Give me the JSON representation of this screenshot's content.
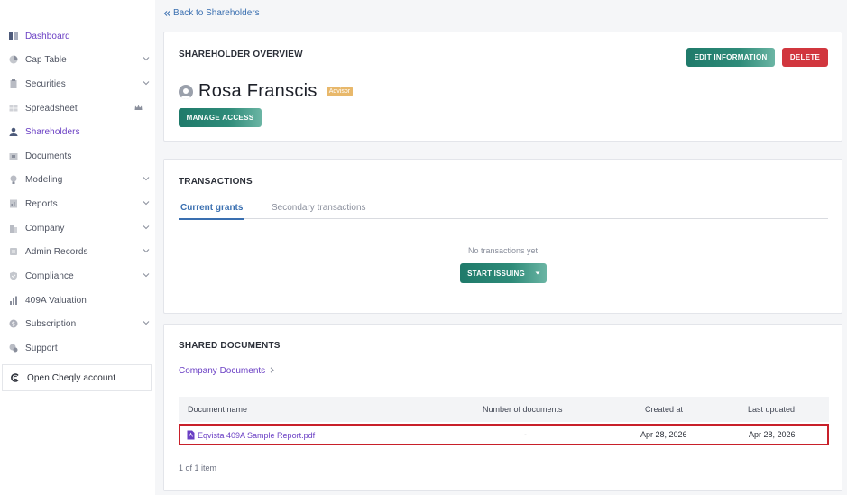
{
  "sidebar": {
    "items": [
      {
        "label": "Dashboard"
      },
      {
        "label": "Cap Table"
      },
      {
        "label": "Securities"
      },
      {
        "label": "Spreadsheet"
      },
      {
        "label": "Shareholders"
      },
      {
        "label": "Documents"
      },
      {
        "label": "Modeling"
      },
      {
        "label": "Reports"
      },
      {
        "label": "Company"
      },
      {
        "label": "Admin Records"
      },
      {
        "label": "Compliance"
      },
      {
        "label": "409A Valuation"
      },
      {
        "label": "Subscription"
      },
      {
        "label": "Support"
      }
    ],
    "cheqly_label": "Open Cheqly account"
  },
  "back_link": "Back to Shareholders",
  "overview": {
    "title": "SHAREHOLDER OVERVIEW",
    "edit_label": "EDIT INFORMATION",
    "delete_label": "DELETE",
    "name": "Rosa Franscis",
    "role_badge": "Advisor",
    "manage_access_label": "MANAGE ACCESS"
  },
  "transactions": {
    "title": "TRANSACTIONS",
    "tabs": [
      {
        "label": "Current grants"
      },
      {
        "label": "Secondary transactions"
      }
    ],
    "empty_text": "No transactions yet",
    "start_issuing_label": "START ISSUING"
  },
  "shared_documents": {
    "title": "SHARED DOCUMENTS",
    "company_documents_link": "Company Documents",
    "columns": [
      "Document name",
      "Number of documents",
      "Created at",
      "Last updated"
    ],
    "rows": [
      {
        "name": "Eqvista 409A Sample Report.pdf",
        "count": "-",
        "created": "Apr 28, 2026",
        "updated": "Apr 28, 2026"
      }
    ],
    "pagination": "1 of 1 item"
  },
  "colors": {
    "accent_purple": "#6a3fc4",
    "primary_green": "#1f7a6a",
    "danger_red": "#d1363e",
    "badge_orange": "#e8b86b",
    "link_blue": "#3a6fb0"
  }
}
